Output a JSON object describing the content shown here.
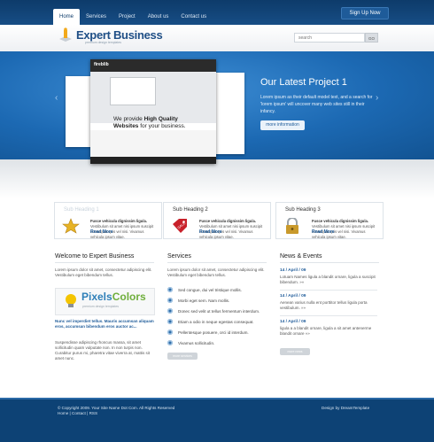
{
  "nav": {
    "items": [
      "Home",
      "Services",
      "Project",
      "About us",
      "Contact us"
    ],
    "signup": "Sign Up Now"
  },
  "logo": {
    "title": "Expert Business",
    "subtitle": "premium design templates"
  },
  "search": {
    "placeholder": "search",
    "go": "GO"
  },
  "hero": {
    "screen_logo": "fireblib",
    "screen_text_1": "We provide ",
    "screen_text_bold": "High Quality Websites",
    "screen_text_2": " for your business.",
    "title": "Our Latest Project 1",
    "text": "Lorem ipsum as their default model text, and a search for 'lorem ipsum' will uncover many web sites still in their infancy.",
    "more": "more information"
  },
  "boxes": [
    {
      "heading": "Sub Heading 1",
      "lead": "Fusce vehicula dignissim ligula.",
      "text": "Vestibulum sit amet nisi ipsum suscipit consequat quis vel nisi. Vivamus vehicula ipsum vitae.",
      "read": "Read More",
      "icon": "star-badge-icon"
    },
    {
      "heading": "Sub Heading 2",
      "lead": "Fusce vehicula dignissim ligula.",
      "text": "Vestibulum sit amet nisi ipsum suscipit consequat quis vel nisi. Vivamus vehicula ipsum vitae.",
      "read": "Read More",
      "icon": "sale-tag-icon"
    },
    {
      "heading": "Sub Heading 3",
      "lead": "Fusce vehicula dignissim ligula.",
      "text": "Vestibulum sit amet nisi ipsum suscipit consequat quis vel nisi. Vivamus vehicula ipsum vitae.",
      "read": "Read More",
      "icon": "padlock-icon"
    }
  ],
  "welcome": {
    "heading": "Welcome to Expert Business",
    "intro": "Lorem ipsum dolor sit amet, consectetur adipiscing elit. Vestibulum eget bibendum tellus.",
    "logo_a": "Pixels",
    "logo_b": "Colors",
    "logo_sub": "premium design templates",
    "bold_text": "Nunc vel imperdiet tellus. Mauris accumsan aliquam eros, accumsan bibendum eros auctor ac...",
    "body": "Suspendisse adipiscing rhoncus massa, sit amet sollicitudin quam vulputate non. In non turpis non. Curabitur purus mi, pharetra vitae viverra at, mattis sit amet nunc."
  },
  "services": {
    "heading": "Services",
    "intro": "Lorem ipsum dolor sit amet, consectetur adipiscing elit. Vestibulum eget bibendum tellus.",
    "items": [
      "Sed congue, dui vel tristique mollis.",
      "Morbi eget sem. Nam mollis.",
      "Donec sed velit ut tellus fermentum interdum.",
      "Etiam a odio in neque egestas consequat.",
      "Pellentesque posuere, orci id interdum.",
      "Vivamus sollicitudin."
    ],
    "button": "more services"
  },
  "news": {
    "heading": "News & Events",
    "items": [
      {
        "date": "14 / April / 09",
        "text": "Lotuam Names ligula a blandit ornare, ligula a suscipit bibendum.",
        "more": "»»"
      },
      {
        "date": "14 / April / 09",
        "text": "Aenean varius nulla ent porttitor tellus ligula porta vestibulum.",
        "more": "»»"
      },
      {
        "date": "14 / April / 09",
        "text": "ligula a a blandit ornare, ligula a sit amet antenerme blandit ornare",
        "more": "»»"
      }
    ],
    "button": "more news"
  },
  "footer": {
    "copyright": "© Copyright 2009. Your Site Name Dot Com. All Rights Reserved",
    "links": "Home | Contact | RSS",
    "credit": "Design by DreamTemplate"
  }
}
